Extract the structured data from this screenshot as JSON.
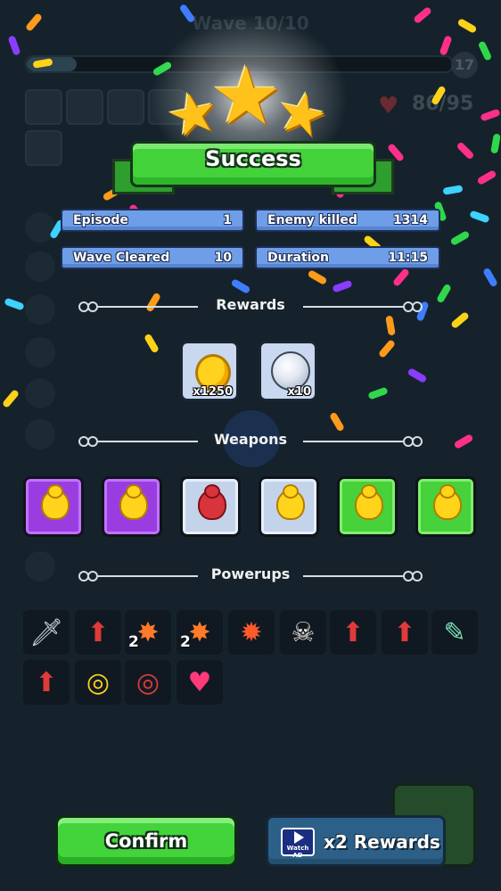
{
  "background_hud": {
    "wave": "Wave 10/10",
    "level": "17",
    "hp": "86/95"
  },
  "header": {
    "title": "Success",
    "stars": 3
  },
  "stats": {
    "episode_label": "Episode",
    "episode_value": "1",
    "enemy_label": "Enemy killed",
    "enemy_value": "1314",
    "wave_label": "Wave Cleared",
    "wave_value": "10",
    "duration_label": "Duration",
    "duration_value": "11:15"
  },
  "sections": {
    "rewards": "Rewards",
    "weapons": "Weapons",
    "powerups": "Powerups"
  },
  "rewards": [
    {
      "icon": "coin-icon",
      "count": "x1250"
    },
    {
      "icon": "pearl-icon",
      "count": "x10"
    }
  ],
  "weapons": [
    {
      "icon": "yellow-blob-weapon-icon",
      "rarity": "purple"
    },
    {
      "icon": "yellow-blob-weapon-icon",
      "rarity": "purple"
    },
    {
      "icon": "red-blob-weapon-icon",
      "rarity": "blue"
    },
    {
      "icon": "yellow-blob-weapon-icon",
      "rarity": "blue"
    },
    {
      "icon": "yellow-blob-weapon-icon",
      "rarity": "green"
    },
    {
      "icon": "yellow-blob-weapon-icon",
      "rarity": "green"
    }
  ],
  "powerups": [
    {
      "icon": "sword-speed-icon",
      "num": ""
    },
    {
      "icon": "cannon-up-icon",
      "num": ""
    },
    {
      "icon": "explosion-plus-icon",
      "num": "2"
    },
    {
      "icon": "explosion-up-icon",
      "num": "2"
    },
    {
      "icon": "explosion-cross-icon",
      "num": ""
    },
    {
      "icon": "skull-icon",
      "num": ""
    },
    {
      "icon": "cannon-fire-up-icon",
      "num": ""
    },
    {
      "icon": "cannon-fire-up-icon",
      "num": ""
    },
    {
      "icon": "syringe-icon",
      "num": ""
    },
    {
      "icon": "cannon-up-icon",
      "num": ""
    },
    {
      "icon": "target-bullets-icon",
      "num": ""
    },
    {
      "icon": "cannon-target-icon",
      "num": ""
    },
    {
      "icon": "strength-heart-icon",
      "num": ""
    }
  ],
  "buttons": {
    "confirm": "Confirm",
    "ad_badge": "Watch AD",
    "double_rewards": "x2 Rewards"
  },
  "colors": {
    "background": "#15222b",
    "success_green": "#44d23a",
    "pill_blue": "#6f9ee8",
    "rarity_purple": "#9a3de0",
    "rarity_blue": "#c3d3ea",
    "rarity_green": "#47d13a"
  }
}
